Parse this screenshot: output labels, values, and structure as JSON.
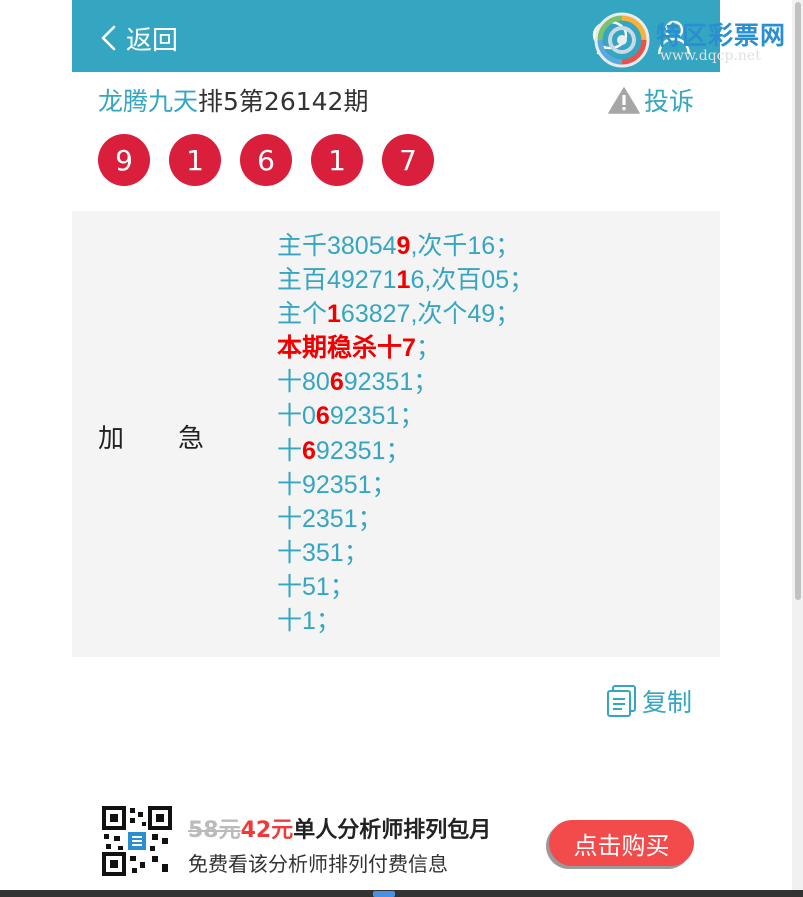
{
  "header": {
    "back_label": "返回",
    "bg_color": "#34a6c1",
    "icons": [
      "chevron-left-icon",
      "chat-icon",
      "user-icon"
    ]
  },
  "watermark": {
    "title": "特区彩票网",
    "url": "www.dqcp.net"
  },
  "issue": {
    "author": "龙腾九天",
    "title_rest": "排5第26142期",
    "complain_label": "投诉"
  },
  "balls": [
    "9",
    "1",
    "6",
    "1",
    "7"
  ],
  "ball_color": "#d91f3b",
  "content": {
    "label": "加急",
    "lines": [
      {
        "pre": "主千38054",
        "hl": "9",
        "post": ",次千16；"
      },
      {
        "pre": "主百49271",
        "hl": "1",
        "post": "6,次百05；"
      },
      {
        "pre": "主个",
        "hl": "1",
        "post": "63827,次个49；"
      },
      {
        "pre": "",
        "hl": "本期稳杀十7",
        "post": "；"
      },
      {
        "pre": "十80",
        "hl": "6",
        "post": "92351；"
      },
      {
        "pre": "十0",
        "hl": "6",
        "post": "92351；"
      },
      {
        "pre": "十",
        "hl": "6",
        "post": "92351；"
      },
      {
        "pre": "十92351；",
        "hl": "",
        "post": ""
      },
      {
        "pre": "十2351；",
        "hl": "",
        "post": ""
      },
      {
        "pre": "十351；",
        "hl": "",
        "post": ""
      },
      {
        "pre": "十51；",
        "hl": "",
        "post": ""
      },
      {
        "pre": "十1；",
        "hl": "",
        "post": ""
      }
    ]
  },
  "copy_label": "复制",
  "promo": {
    "old_price": "58元",
    "new_price": "42元",
    "title": "单人分析师排列包月",
    "subtitle": "免费看该分析师排列付费信息",
    "buy_label": "点击购买"
  }
}
